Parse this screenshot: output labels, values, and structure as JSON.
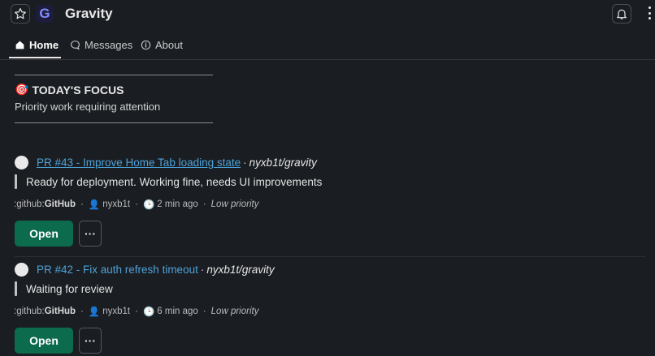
{
  "app": {
    "title": "Gravity",
    "logo_letter": "G"
  },
  "tabs": [
    {
      "label": "Home",
      "icon": "home-icon",
      "active": true
    },
    {
      "label": "Messages",
      "icon": "chat-bubble-icon",
      "active": false
    },
    {
      "label": "About",
      "icon": "info-icon",
      "active": false
    }
  ],
  "focus": {
    "emoji": "🎯",
    "title": "TODAY'S FOCUS",
    "subtitle": "Priority work requiring attention"
  },
  "items": [
    {
      "link": "PR #43 - Improve Home Tab loading state",
      "bullet": "·",
      "repo": "nyxb1t/gravity",
      "note": "Ready for deployment. Working fine, needs UI improvements",
      "meta": {
        "source_prefix": ":github:",
        "source": "GitHub",
        "user": "nyxb1t",
        "time": "2 min ago",
        "priority": "Low priority"
      },
      "open_label": "Open",
      "more_label": "···"
    },
    {
      "link": "PR #42 - Fix auth refresh timeout",
      "bullet": "·",
      "repo": "nyxb1t/gravity",
      "note": "Waiting for review",
      "meta": {
        "source_prefix": ":github:",
        "source": "GitHub",
        "user": "nyxb1t",
        "time": "6 min ago",
        "priority": "Low priority"
      },
      "open_label": "Open",
      "more_label": "···"
    }
  ],
  "colors": {
    "background": "#1a1d21",
    "link": "#4ea3d9",
    "open_button": "#0b6b4c"
  }
}
